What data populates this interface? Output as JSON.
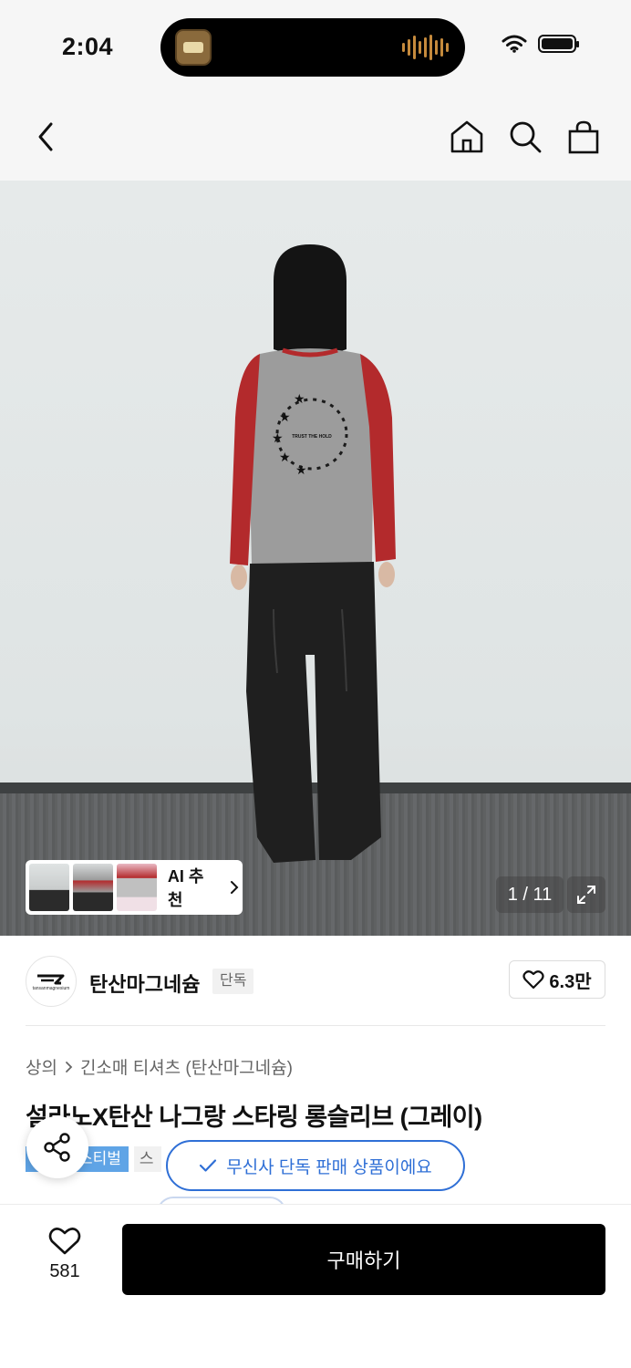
{
  "status_bar": {
    "time": "2:04"
  },
  "nav": {
    "back_icon": "chevron-left-icon",
    "home_icon": "home-icon",
    "search_icon": "search-icon",
    "bag_icon": "shopping-bag-icon"
  },
  "gallery": {
    "ai_recommend_label": "AI 추천",
    "page_counter": "1 / 11",
    "expand_icon": "expand-icon",
    "print_text": "TRUST THE HOLD"
  },
  "brand": {
    "logo_text": "tansanmagnesium",
    "name": "탄산마그네슘",
    "badge": "단독",
    "likes": "6.3만"
  },
  "breadcrumb": {
    "level1": "상의",
    "level2": "긴소매 티셔츠 (탄산마그네슘)"
  },
  "product": {
    "title": "설라노X탄산 나그랑 스타링 롱슬리브 (그레이)",
    "tag_festival": "스티벌",
    "tag_gray": "스"
  },
  "toast": {
    "text": "무신사 단독 판매 상품이에요"
  },
  "bottom": {
    "wish_count": "581",
    "buy_label": "구매하기"
  },
  "colors": {
    "accent_blue": "#2f6fd6",
    "festival_blue": "#5fa4e6",
    "buy_button": "#000000",
    "sleeve_red": "#b32a2c"
  }
}
